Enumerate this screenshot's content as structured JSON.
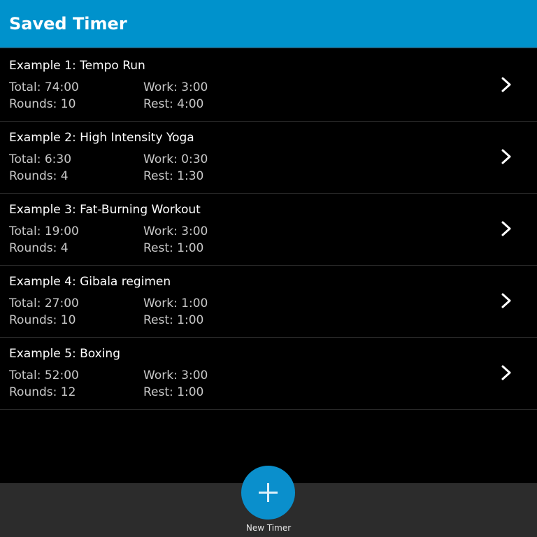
{
  "header": {
    "title": "Saved Timer"
  },
  "timers": [
    {
      "name": "Example 1:  Tempo Run",
      "total": "Total:  74:00",
      "rounds": "Rounds: 10",
      "work": "Work: 3:00",
      "rest": "Rest:  4:00"
    },
    {
      "name": "Example 2:  High Intensity Yoga",
      "total": "Total:  6:30",
      "rounds": "Rounds: 4",
      "work": "Work: 0:30",
      "rest": "Rest:  1:30"
    },
    {
      "name": "Example 3:  Fat-Burning Workout",
      "total": "Total:  19:00",
      "rounds": "Rounds: 4",
      "work": "Work: 3:00",
      "rest": "Rest:  1:00"
    },
    {
      "name": "Example 4:  Gibala regimen",
      "total": "Total:  27:00",
      "rounds": "Rounds: 10",
      "work": "Work: 1:00",
      "rest": "Rest:  1:00"
    },
    {
      "name": "Example 5:  Boxing",
      "total": "Total:  52:00",
      "rounds": "Rounds: 12",
      "work": "Work: 3:00",
      "rest": "Rest:  1:00"
    }
  ],
  "action_bar": {
    "new_timer_label": "New Timer",
    "new_timer_icon": "plus-icon"
  },
  "colors": {
    "accent": "#0092cc",
    "background": "#000000",
    "action_bar": "#2c2c2c"
  }
}
